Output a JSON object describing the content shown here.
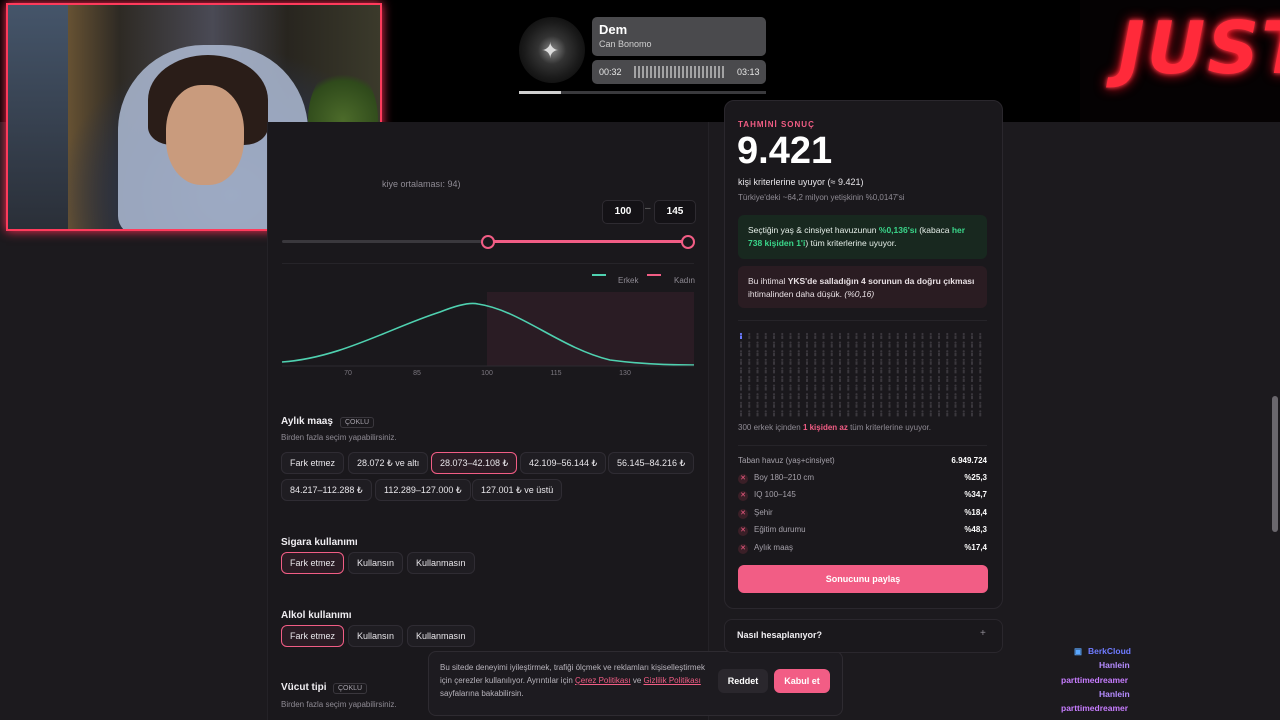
{
  "music": {
    "title": "Dem",
    "artist": "Can Bonomo",
    "elapsed": "00:32",
    "duration": "03:13",
    "progress": 0.17
  },
  "logo_text": "JUST",
  "iq": {
    "avg_text": "kiye ortalaması: 94)",
    "min": "100",
    "max": "145",
    "legend_male": "Erkek",
    "legend_female": "Kadın",
    "ticks": [
      "70",
      "85",
      "100",
      "115",
      "130"
    ]
  },
  "salary": {
    "title": "Aylık maaş",
    "badge": "ÇOKLU",
    "hint": "Birden fazla seçim yapabilirsiniz.",
    "options": [
      "Fark etmez",
      "28.072 ₺ ve altı",
      "28.073–42.108 ₺",
      "42.109–56.144 ₺",
      "56.145–84.216 ₺",
      "84.217–112.288 ₺",
      "112.289–127.000 ₺",
      "127.001 ₺ ve üstü"
    ],
    "selected": "28.073–42.108 ₺"
  },
  "smoking": {
    "title": "Sigara kullanımı",
    "options": [
      "Fark etmez",
      "Kullansın",
      "Kullanmasın"
    ],
    "selected": "Fark etmez"
  },
  "alcohol": {
    "title": "Alkol kullanımı",
    "options": [
      "Fark etmez",
      "Kullansın",
      "Kullanmasın"
    ],
    "selected": "Fark etmez"
  },
  "body": {
    "title": "Vücut tipi",
    "badge": "ÇOKLU",
    "hint": "Birden fazla seçim yapabilirsiniz."
  },
  "cookie": {
    "text1": "Bu sitede deneyimi iyileştirmek, trafiği ölçmek ve reklamları kişiselleştirmek için çerezler kullanılıyor. Ayrıntılar için ",
    "link1": "Çerez Politikası",
    "text2": " ve ",
    "link2": "Gizlilik Politikası",
    "text3": " sayfalarına bakabilirsin.",
    "reject": "Reddet",
    "accept": "Kabul et"
  },
  "result": {
    "tag": "TAHMİNİ SONUÇ",
    "count": "9.421",
    "line1": "kişi kriterlerine uyuyor (≈ 9.421)",
    "line2": "Türkiye'deki ~64,2 milyon yetişkinin %0,0147'si",
    "green_a": "Seçtiğin yaş & cinsiyet havuzunun ",
    "green_pct": "%0,136'sı",
    "green_b": " (kabaca ",
    "green_ratio": "her 738 kişiden 1'i",
    "green_c": ") tüm kriterlerine uyuyor.",
    "red_a": "Bu ihtimal ",
    "red_bold": "YKS'de salladığın 4 sorunun da doğru çıkması",
    "red_b": " ihtimalinden daha düşük. ",
    "red_italic": "(%0,16)",
    "grid_caption_a": "300 erkek içinden ",
    "grid_caption_b": "1 kişiden az",
    "grid_caption_c": " tüm kriterlerine uyuyor.",
    "pool_label": "Taban havuz (yaş+cinsiyet)",
    "pool_value": "6.949.724",
    "stats": [
      {
        "label": "Boy 180–210 cm",
        "value": "%25,3"
      },
      {
        "label": "IQ 100–145",
        "value": "%34,7"
      },
      {
        "label": "Şehir",
        "value": "%18,4"
      },
      {
        "label": "Eğitim durumu",
        "value": "%48,3"
      },
      {
        "label": "Aylık maaş",
        "value": "%17,4"
      }
    ],
    "share": "Sonucunu paylaş",
    "how": "Nasıl hesaplanıyor?",
    "how_icon": "+"
  },
  "chat": [
    {
      "user": "BerkCloud",
      "color": "#6f7bff"
    },
    {
      "user": "Hanlein",
      "color": "#b58cff"
    },
    {
      "user": "parttimedreamer",
      "color": "#c77dff"
    },
    {
      "user": "Hanlein",
      "color": "#b58cff"
    },
    {
      "user": "parttimedreamer",
      "color": "#c77dff"
    }
  ],
  "colors": {
    "accent": "#f25d85",
    "male_curve": "#4fd1b0",
    "green": "#3ad68a"
  }
}
